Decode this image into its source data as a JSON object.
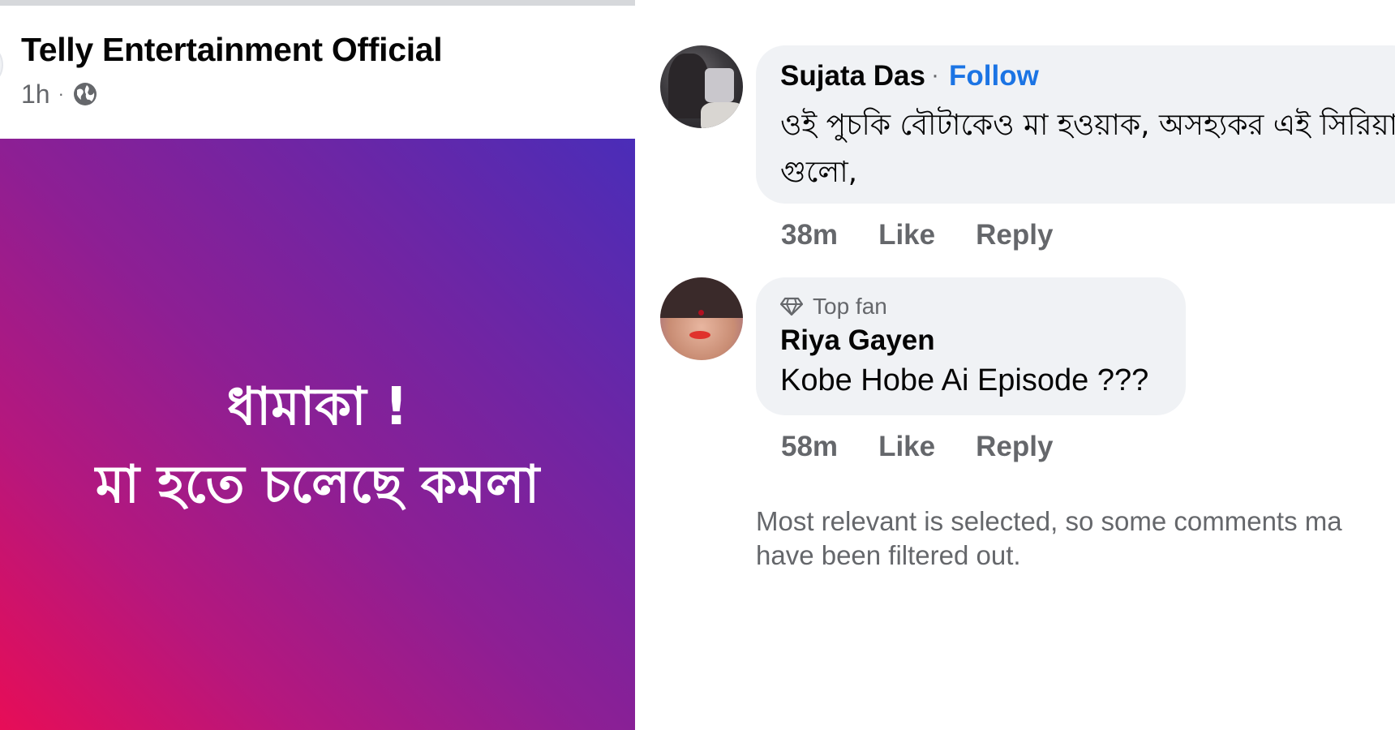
{
  "post": {
    "page_name": "Telly Entertainment Official",
    "time": "1h",
    "meta_separator": "·",
    "privacy_icon": "globe-icon",
    "image_text": {
      "line1": "ধামাকা !",
      "line2": "মা হতে চলেছে কমলা"
    },
    "gradient_colors": [
      "#4a2db8",
      "#8d1f94",
      "#e70d57"
    ]
  },
  "comments": [
    {
      "author": "Sujata Das",
      "separator": "·",
      "follow_label": "Follow",
      "text": "ওই পুচকি বৌটাকেও মা হওয়াক, অসহ্যকর এই সিরিয়াল গুলো,",
      "time": "38m",
      "like_label": "Like",
      "reply_label": "Reply"
    },
    {
      "badge": "Top fan",
      "badge_icon": "diamond-icon",
      "author": "Riya Gayen",
      "text": "Kobe Hobe Ai Episode ???",
      "time": "58m",
      "like_label": "Like",
      "reply_label": "Reply"
    }
  ],
  "filter_note": {
    "line1": "Most relevant is selected, so some comments ma",
    "line2": "have been filtered out."
  },
  "colors": {
    "link_blue": "#1b74e4",
    "bubble_bg": "#f0f2f5",
    "secondary_text": "#65676b"
  }
}
